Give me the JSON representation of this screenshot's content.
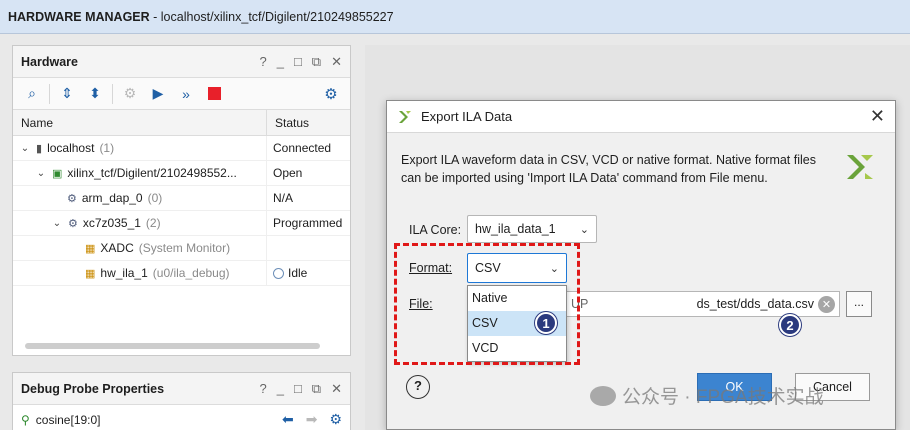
{
  "window": {
    "title_prefix": "HARDWARE MANAGER",
    "title_suffix": " - localhost/xilinx_tcf/Digilent/210249855227"
  },
  "hardware_panel": {
    "title": "Hardware",
    "columns": {
      "name": "Name",
      "status": "Status"
    },
    "rows": [
      {
        "name": "localhost",
        "suffix": " (1)",
        "status": "Connected",
        "caret": "⌄",
        "icon": "server-icon"
      },
      {
        "name": "xilinx_tcf/Digilent/2102498552...",
        "suffix": "",
        "status": "Open",
        "caret": "⌄",
        "icon": "cable-icon"
      },
      {
        "name": "arm_dap_0",
        "suffix": " (0)",
        "status": "N/A",
        "caret": "",
        "icon": "chip-icon"
      },
      {
        "name": "xc7z035_1",
        "suffix": " (2)",
        "status": "Programmed",
        "caret": "⌄",
        "icon": "chip-icon"
      },
      {
        "name": "XADC",
        "suffix": " (System Monitor)",
        "status": "",
        "caret": "",
        "icon": "xadc-icon"
      },
      {
        "name": "hw_ila_1",
        "suffix": " (u0/ila_debug)",
        "status": "Idle",
        "caret": "",
        "icon": "ila-icon"
      }
    ]
  },
  "debug_panel": {
    "title": "Debug Probe Properties",
    "probe": "cosine[19:0]"
  },
  "dialog": {
    "title": "Export ILA Data",
    "description": "Export ILA waveform data in CSV, VCD or native format. Native format files can be imported using 'Import ILA Data' command from File menu.",
    "ila_core_label": "ILA Core:",
    "ila_core_value": "hw_ila_data_1",
    "format_label": "Format:",
    "format_value": "CSV",
    "format_options": [
      "Native",
      "CSV",
      "VCD"
    ],
    "file_label": "File:",
    "file_value_hidden": "UP",
    "file_value": "ds_test/dds_data.csv",
    "browse_label": "...",
    "ok_label": "OK",
    "cancel_label": "Cancel",
    "help_label": "?"
  },
  "badges": {
    "one": "1",
    "two": "2"
  },
  "watermark": {
    "text": "公众号 · FPGA技术实战"
  },
  "colors": {
    "accent": "#1f5fa5",
    "highlight": "#e01818",
    "ok": "#3c84d0"
  }
}
